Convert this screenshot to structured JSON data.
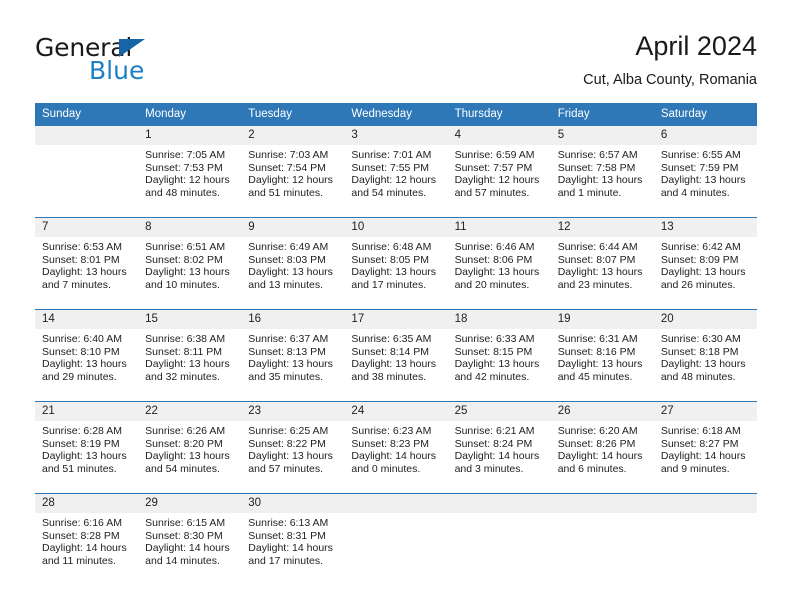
{
  "logo": {
    "word_one": "General",
    "word_two": "Blue",
    "triangle_color": "#1565a8",
    "blue_color": "#1d7fc4"
  },
  "header": {
    "title": "April 2024",
    "subtitle": "Cut, Alba County, Romania"
  },
  "theme": {
    "header_bar": "#2e78b8",
    "daynum_bg": "#f0f0f0",
    "text": "#222222"
  },
  "weekdays": [
    "Sunday",
    "Monday",
    "Tuesday",
    "Wednesday",
    "Thursday",
    "Friday",
    "Saturday"
  ],
  "weeks": [
    [
      {
        "day": "",
        "sunrise": "",
        "sunset": "",
        "daylight1": "",
        "daylight2": ""
      },
      {
        "day": "1",
        "sunrise": "Sunrise: 7:05 AM",
        "sunset": "Sunset: 7:53 PM",
        "daylight1": "Daylight: 12 hours",
        "daylight2": "and 48 minutes."
      },
      {
        "day": "2",
        "sunrise": "Sunrise: 7:03 AM",
        "sunset": "Sunset: 7:54 PM",
        "daylight1": "Daylight: 12 hours",
        "daylight2": "and 51 minutes."
      },
      {
        "day": "3",
        "sunrise": "Sunrise: 7:01 AM",
        "sunset": "Sunset: 7:55 PM",
        "daylight1": "Daylight: 12 hours",
        "daylight2": "and 54 minutes."
      },
      {
        "day": "4",
        "sunrise": "Sunrise: 6:59 AM",
        "sunset": "Sunset: 7:57 PM",
        "daylight1": "Daylight: 12 hours",
        "daylight2": "and 57 minutes."
      },
      {
        "day": "5",
        "sunrise": "Sunrise: 6:57 AM",
        "sunset": "Sunset: 7:58 PM",
        "daylight1": "Daylight: 13 hours",
        "daylight2": "and 1 minute."
      },
      {
        "day": "6",
        "sunrise": "Sunrise: 6:55 AM",
        "sunset": "Sunset: 7:59 PM",
        "daylight1": "Daylight: 13 hours",
        "daylight2": "and 4 minutes."
      }
    ],
    [
      {
        "day": "7",
        "sunrise": "Sunrise: 6:53 AM",
        "sunset": "Sunset: 8:01 PM",
        "daylight1": "Daylight: 13 hours",
        "daylight2": "and 7 minutes."
      },
      {
        "day": "8",
        "sunrise": "Sunrise: 6:51 AM",
        "sunset": "Sunset: 8:02 PM",
        "daylight1": "Daylight: 13 hours",
        "daylight2": "and 10 minutes."
      },
      {
        "day": "9",
        "sunrise": "Sunrise: 6:49 AM",
        "sunset": "Sunset: 8:03 PM",
        "daylight1": "Daylight: 13 hours",
        "daylight2": "and 13 minutes."
      },
      {
        "day": "10",
        "sunrise": "Sunrise: 6:48 AM",
        "sunset": "Sunset: 8:05 PM",
        "daylight1": "Daylight: 13 hours",
        "daylight2": "and 17 minutes."
      },
      {
        "day": "11",
        "sunrise": "Sunrise: 6:46 AM",
        "sunset": "Sunset: 8:06 PM",
        "daylight1": "Daylight: 13 hours",
        "daylight2": "and 20 minutes."
      },
      {
        "day": "12",
        "sunrise": "Sunrise: 6:44 AM",
        "sunset": "Sunset: 8:07 PM",
        "daylight1": "Daylight: 13 hours",
        "daylight2": "and 23 minutes."
      },
      {
        "day": "13",
        "sunrise": "Sunrise: 6:42 AM",
        "sunset": "Sunset: 8:09 PM",
        "daylight1": "Daylight: 13 hours",
        "daylight2": "and 26 minutes."
      }
    ],
    [
      {
        "day": "14",
        "sunrise": "Sunrise: 6:40 AM",
        "sunset": "Sunset: 8:10 PM",
        "daylight1": "Daylight: 13 hours",
        "daylight2": "and 29 minutes."
      },
      {
        "day": "15",
        "sunrise": "Sunrise: 6:38 AM",
        "sunset": "Sunset: 8:11 PM",
        "daylight1": "Daylight: 13 hours",
        "daylight2": "and 32 minutes."
      },
      {
        "day": "16",
        "sunrise": "Sunrise: 6:37 AM",
        "sunset": "Sunset: 8:13 PM",
        "daylight1": "Daylight: 13 hours",
        "daylight2": "and 35 minutes."
      },
      {
        "day": "17",
        "sunrise": "Sunrise: 6:35 AM",
        "sunset": "Sunset: 8:14 PM",
        "daylight1": "Daylight: 13 hours",
        "daylight2": "and 38 minutes."
      },
      {
        "day": "18",
        "sunrise": "Sunrise: 6:33 AM",
        "sunset": "Sunset: 8:15 PM",
        "daylight1": "Daylight: 13 hours",
        "daylight2": "and 42 minutes."
      },
      {
        "day": "19",
        "sunrise": "Sunrise: 6:31 AM",
        "sunset": "Sunset: 8:16 PM",
        "daylight1": "Daylight: 13 hours",
        "daylight2": "and 45 minutes."
      },
      {
        "day": "20",
        "sunrise": "Sunrise: 6:30 AM",
        "sunset": "Sunset: 8:18 PM",
        "daylight1": "Daylight: 13 hours",
        "daylight2": "and 48 minutes."
      }
    ],
    [
      {
        "day": "21",
        "sunrise": "Sunrise: 6:28 AM",
        "sunset": "Sunset: 8:19 PM",
        "daylight1": "Daylight: 13 hours",
        "daylight2": "and 51 minutes."
      },
      {
        "day": "22",
        "sunrise": "Sunrise: 6:26 AM",
        "sunset": "Sunset: 8:20 PM",
        "daylight1": "Daylight: 13 hours",
        "daylight2": "and 54 minutes."
      },
      {
        "day": "23",
        "sunrise": "Sunrise: 6:25 AM",
        "sunset": "Sunset: 8:22 PM",
        "daylight1": "Daylight: 13 hours",
        "daylight2": "and 57 minutes."
      },
      {
        "day": "24",
        "sunrise": "Sunrise: 6:23 AM",
        "sunset": "Sunset: 8:23 PM",
        "daylight1": "Daylight: 14 hours",
        "daylight2": "and 0 minutes."
      },
      {
        "day": "25",
        "sunrise": "Sunrise: 6:21 AM",
        "sunset": "Sunset: 8:24 PM",
        "daylight1": "Daylight: 14 hours",
        "daylight2": "and 3 minutes."
      },
      {
        "day": "26",
        "sunrise": "Sunrise: 6:20 AM",
        "sunset": "Sunset: 8:26 PM",
        "daylight1": "Daylight: 14 hours",
        "daylight2": "and 6 minutes."
      },
      {
        "day": "27",
        "sunrise": "Sunrise: 6:18 AM",
        "sunset": "Sunset: 8:27 PM",
        "daylight1": "Daylight: 14 hours",
        "daylight2": "and 9 minutes."
      }
    ],
    [
      {
        "day": "28",
        "sunrise": "Sunrise: 6:16 AM",
        "sunset": "Sunset: 8:28 PM",
        "daylight1": "Daylight: 14 hours",
        "daylight2": "and 11 minutes."
      },
      {
        "day": "29",
        "sunrise": "Sunrise: 6:15 AM",
        "sunset": "Sunset: 8:30 PM",
        "daylight1": "Daylight: 14 hours",
        "daylight2": "and 14 minutes."
      },
      {
        "day": "30",
        "sunrise": "Sunrise: 6:13 AM",
        "sunset": "Sunset: 8:31 PM",
        "daylight1": "Daylight: 14 hours",
        "daylight2": "and 17 minutes."
      },
      {
        "day": "",
        "sunrise": "",
        "sunset": "",
        "daylight1": "",
        "daylight2": ""
      },
      {
        "day": "",
        "sunrise": "",
        "sunset": "",
        "daylight1": "",
        "daylight2": ""
      },
      {
        "day": "",
        "sunrise": "",
        "sunset": "",
        "daylight1": "",
        "daylight2": ""
      },
      {
        "day": "",
        "sunrise": "",
        "sunset": "",
        "daylight1": "",
        "daylight2": ""
      }
    ]
  ]
}
